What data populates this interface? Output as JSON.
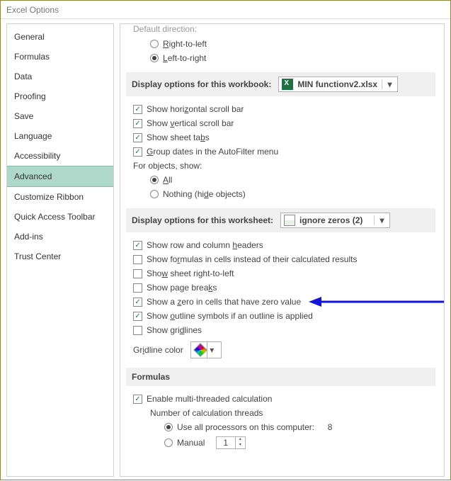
{
  "title": "Excel Options",
  "sidebar": {
    "items": [
      {
        "label": "General"
      },
      {
        "label": "Formulas"
      },
      {
        "label": "Data"
      },
      {
        "label": "Proofing"
      },
      {
        "label": "Save"
      },
      {
        "label": "Language"
      },
      {
        "label": "Accessibility"
      },
      {
        "label": "Advanced"
      },
      {
        "label": "Customize Ribbon"
      },
      {
        "label": "Quick Access Toolbar"
      },
      {
        "label": "Add-ins"
      },
      {
        "label": "Trust Center"
      }
    ],
    "selected": "Advanced"
  },
  "content": {
    "cutoff_heading": "Default direction:",
    "dir_rtl": "Right-to-left",
    "dir_ltr": "Left-to-right",
    "section_workbook": "Display options for this workbook:",
    "workbook_name": "MIN functionv2.xlsx",
    "hscroll": "Show horizontal scroll bar",
    "vscroll": "Show vertical scroll bar",
    "tabs": "Show sheet tabs",
    "group_dates": "Group dates in the AutoFilter menu",
    "for_objects": "For objects, show:",
    "obj_all": "All",
    "obj_nothing": "Nothing (hide objects)",
    "section_worksheet": "Display options for this worksheet:",
    "worksheet_name": "ignore zeros (2)",
    "row_col_headers": "Show row and column headers",
    "show_formulas": "Show formulas in cells instead of their calculated results",
    "sheet_rtl": "Show sheet right-to-left",
    "page_breaks": "Show page breaks",
    "zero_vals": "Show a zero in cells that have zero value",
    "outline_symbols": "Show outline symbols if an outline is applied",
    "gridlines": "Show gridlines",
    "gridline_color": "Gridline color",
    "section_formulas": "Formulas",
    "multi_thread": "Enable multi-threaded calculation",
    "num_threads": "Number of calculation threads",
    "all_proc": "Use all processors on this computer:",
    "all_proc_count": "8",
    "manual": "Manual",
    "manual_val": "1"
  }
}
